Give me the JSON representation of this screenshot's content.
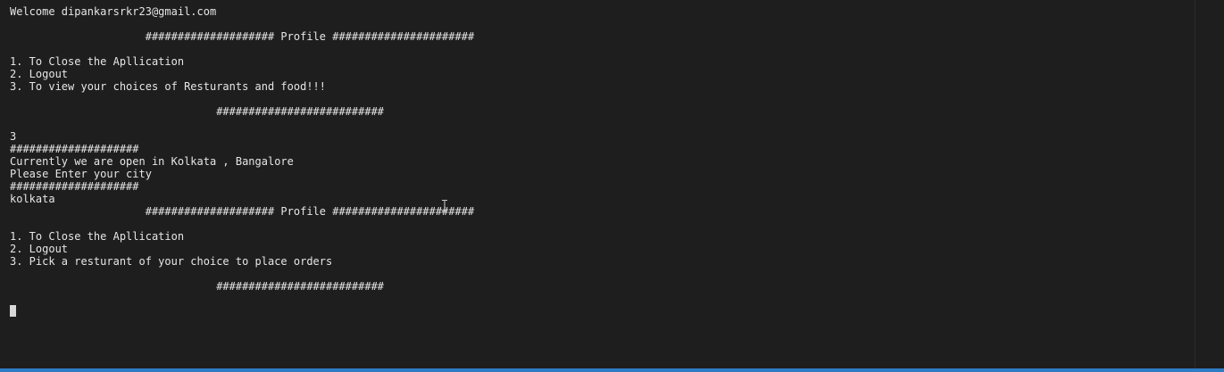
{
  "terminal": {
    "lines": [
      "Welcome dipankarsrkr23@gmail.com",
      "",
      "                     #################### Profile ######################",
      "",
      "1. To Close the Apllication",
      "2. Logout",
      "3. To view your choices of Resturants and food!!!",
      "",
      "                                ##########################",
      "",
      "3",
      "####################",
      "Currently we are open in Kolkata , Bangalore",
      "Please Enter your city",
      "####################",
      "kolkata",
      "                     #################### Profile ######################",
      "",
      "1. To Close the Apllication",
      "2. Logout",
      "3. Pick a resturant of your choice to place orders",
      "",
      "                                ##########################",
      "",
      ""
    ]
  }
}
